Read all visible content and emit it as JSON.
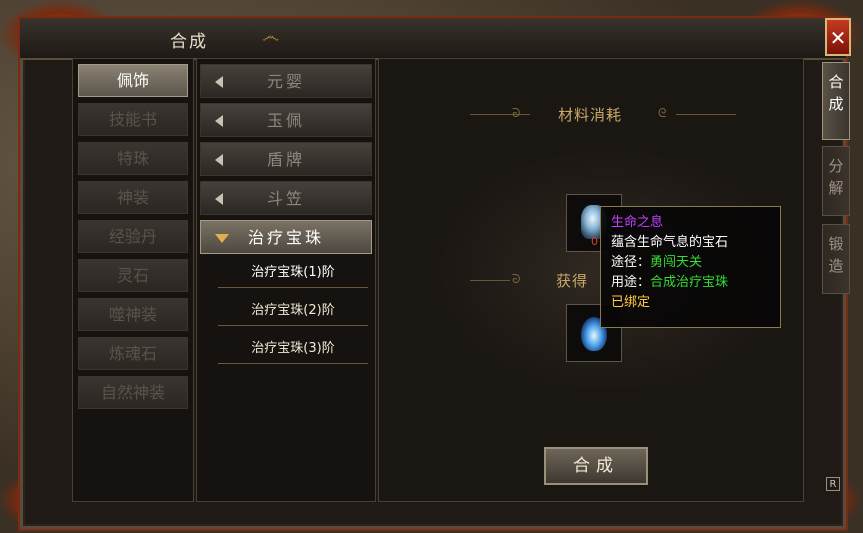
{
  "window": {
    "title": "合成",
    "close_label": "✕"
  },
  "categories": [
    {
      "label": "佩饰",
      "active": true
    },
    {
      "label": "技能书"
    },
    {
      "label": "特珠"
    },
    {
      "label": "神装"
    },
    {
      "label": "经验丹"
    },
    {
      "label": "灵石"
    },
    {
      "label": "噬神装"
    },
    {
      "label": "炼魂石"
    },
    {
      "label": "自然神装"
    }
  ],
  "subcategories": [
    {
      "label": "元婴"
    },
    {
      "label": "玉佩"
    },
    {
      "label": "盾牌"
    },
    {
      "label": "斗笠"
    },
    {
      "label": "治疗宝珠",
      "open": true
    }
  ],
  "recipes": [
    "治疗宝珠(1)阶",
    "治疗宝珠(2)阶",
    "治疗宝珠(3)阶"
  ],
  "materials_header": "材料消耗",
  "output_header": "获得",
  "material_slot": {
    "count": "0"
  },
  "tooltip": {
    "name": "生命之息",
    "description": "蕴含生命气息的宝石",
    "source_label": "途径：",
    "source_value": "勇闯天关",
    "use_label": "用途：",
    "use_value": "合成治疗宝珠",
    "bound": "已绑定",
    "colors": {
      "name": "#c040ff",
      "value": "#33dd33",
      "bound": "#ffd040",
      "text": "#ffffff"
    }
  },
  "craft_button": "合成",
  "side_tabs": [
    {
      "label": "合成",
      "active": true
    },
    {
      "label": "分解"
    },
    {
      "label": "锻造"
    }
  ],
  "corner_box": "R"
}
